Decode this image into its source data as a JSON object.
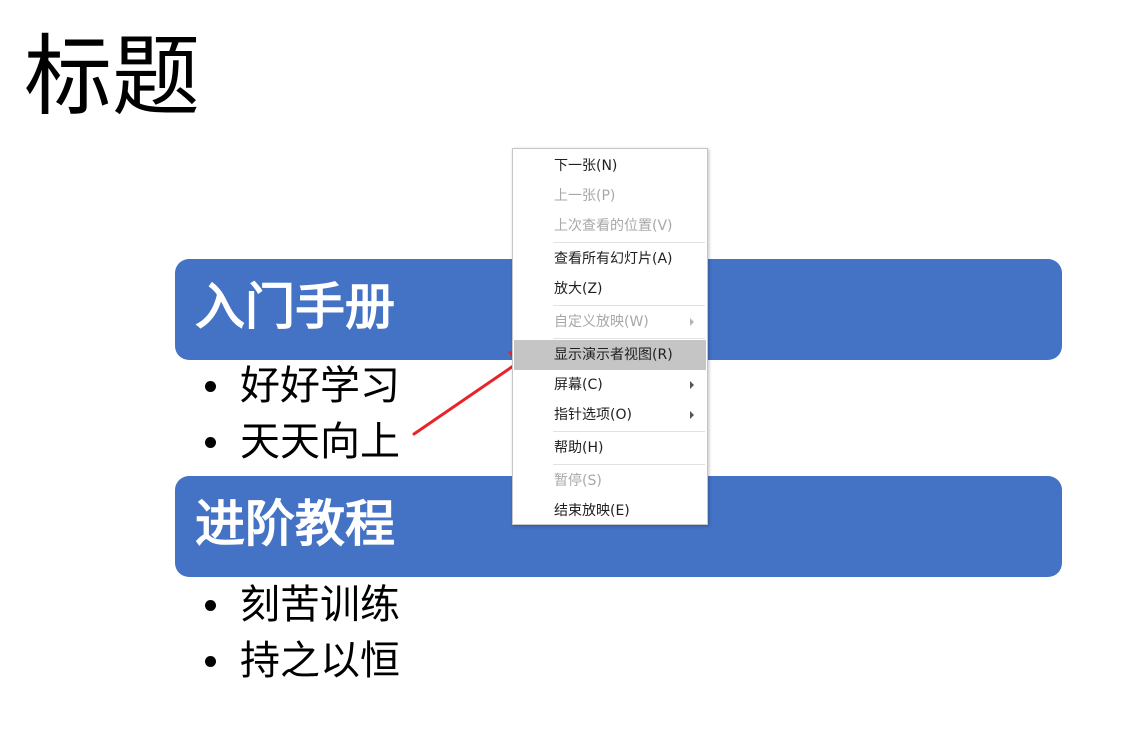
{
  "slide": {
    "title": "标题",
    "sections": [
      {
        "heading": "入门手册",
        "bullets": [
          "好好学习",
          "天天向上"
        ]
      },
      {
        "heading": "进阶教程",
        "bullets": [
          "刻苦训练",
          "持之以恒"
        ]
      }
    ],
    "accent_color": "#4472c4"
  },
  "context_menu": {
    "items": [
      {
        "label": "下一张(N)",
        "enabled": true
      },
      {
        "label": "上一张(P)",
        "enabled": false
      },
      {
        "label": "上次查看的位置(V)",
        "enabled": false
      },
      {
        "label": "查看所有幻灯片(A)",
        "enabled": true
      },
      {
        "label": "放大(Z)",
        "enabled": true
      },
      {
        "label": "自定义放映(W)",
        "enabled": false,
        "submenu": true
      },
      {
        "label": "显示演示者视图(R)",
        "enabled": true,
        "highlighted": true
      },
      {
        "label": "屏幕(C)",
        "enabled": true,
        "submenu": true
      },
      {
        "label": "指针选项(O)",
        "enabled": true,
        "submenu": true
      },
      {
        "label": "帮助(H)",
        "enabled": true
      },
      {
        "label": "暂停(S)",
        "enabled": false
      },
      {
        "label": "结束放映(E)",
        "enabled": true
      }
    ],
    "highlight_color": "#c5c5c5"
  },
  "annotation": {
    "arrow_color": "#e8232a"
  }
}
